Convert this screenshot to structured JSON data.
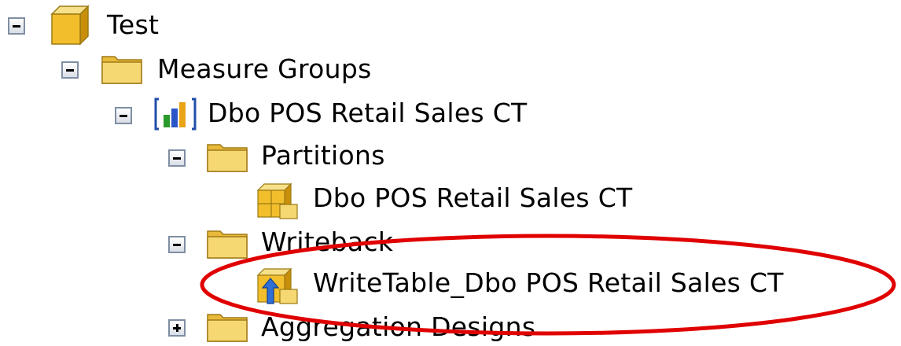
{
  "tree": {
    "root": {
      "label": "Test",
      "expander": "collapse",
      "icon": "cube-icon"
    },
    "measure_groups": {
      "label": "Measure Groups",
      "expander": "collapse",
      "icon": "folder-icon"
    },
    "measure_group": {
      "label": "Dbo POS Retail Sales CT",
      "expander": "collapse",
      "icon": "bar-chart-icon"
    },
    "partitions": {
      "label": "Partitions",
      "expander": "collapse",
      "icon": "folder-icon"
    },
    "partition_item": {
      "label": "Dbo POS Retail Sales CT",
      "icon": "partition-icon"
    },
    "writeback": {
      "label": "Writeback",
      "expander": "collapse",
      "icon": "folder-icon"
    },
    "writeback_item": {
      "label": "WriteTable_Dbo POS Retail Sales CT",
      "icon": "writeback-partition-icon"
    },
    "aggregation_designs": {
      "label": "Aggregation Designs",
      "expander": "expand",
      "icon": "folder-icon"
    }
  },
  "colors": {
    "highlight_ellipse": "#e00000",
    "folder": "#f2c94c",
    "expander_border": "#7f8ea3"
  }
}
